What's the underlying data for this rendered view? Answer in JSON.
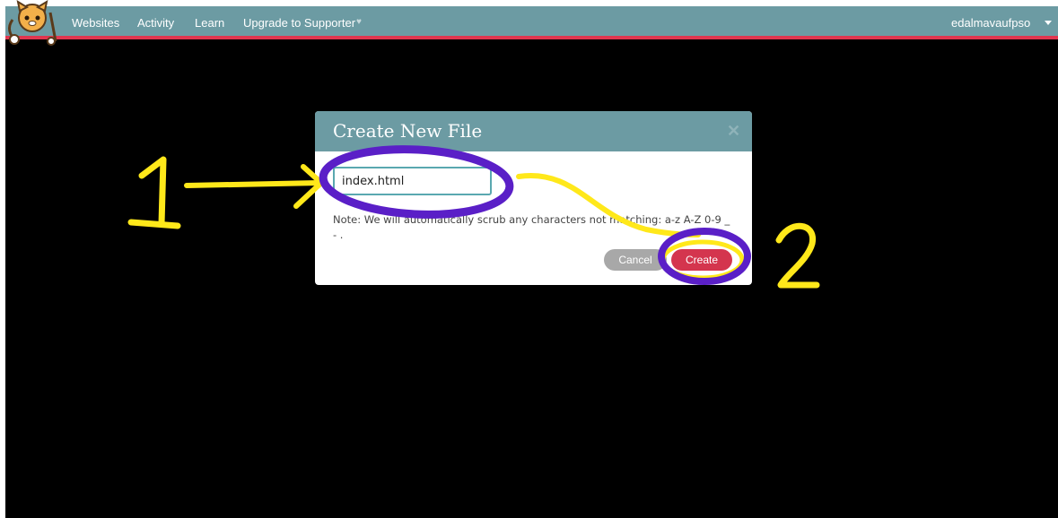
{
  "nav": {
    "items": [
      "Websites",
      "Activity",
      "Learn",
      "Upgrade to Supporter"
    ],
    "username": "edalmavaufpso"
  },
  "modal": {
    "title": "Create New File",
    "filename_value": "index.html",
    "note": "Note: We will automatically scrub any characters not matching: a-z A-Z 0-9 _ - .",
    "cancel_label": "Cancel",
    "create_label": "Create"
  },
  "annotations": {
    "step1": "1",
    "step2": "2"
  },
  "colors": {
    "navbar": "#6c9ba3",
    "navbar_accent": "#e0364f",
    "create_button": "#d4354e",
    "cancel_button": "#a8a8a8",
    "annotation_yellow": "#ffe81a",
    "annotation_purple": "#5a1fc7"
  },
  "icons": {
    "logo": "cat-logo-icon",
    "close": "close-icon",
    "user_menu": "caret-down-icon",
    "supporter": "heart-icon"
  }
}
